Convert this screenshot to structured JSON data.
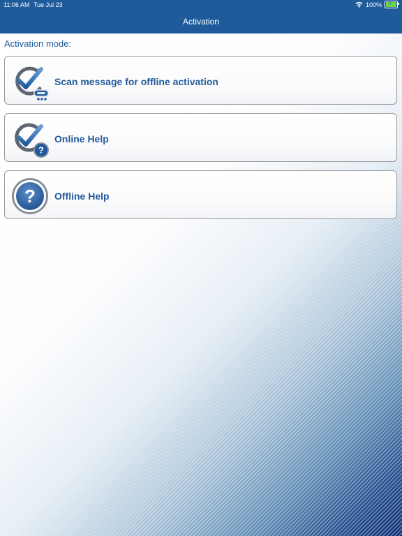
{
  "status_bar": {
    "time": "11:06 AM",
    "date": "Tue Jul 23",
    "battery": "100%",
    "wifi_icon": "wifi-icon",
    "battery_icon": "battery-charging-icon"
  },
  "nav": {
    "title": "Activation"
  },
  "section": {
    "label": "Activation mode:"
  },
  "options": [
    {
      "label": "Scan message for offline activation",
      "icon": "scan-check-icon"
    },
    {
      "label": "Online Help",
      "icon": "online-help-icon"
    },
    {
      "label": "Offline Help",
      "icon": "help-circle-icon"
    }
  ],
  "colors": {
    "header": "#1f5a9b",
    "accent": "#1f5a9b",
    "card_border": "#9a9a9a"
  }
}
